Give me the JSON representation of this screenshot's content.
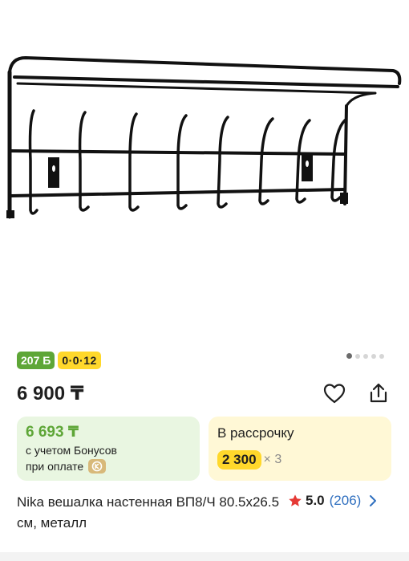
{
  "product_image": {
    "alt_name": "coat-rack-photo"
  },
  "badges": {
    "bonus": "207 Б",
    "plan": "0·0·12"
  },
  "pager": {
    "count": 5,
    "active_index": 0
  },
  "price": "6 900 ₸",
  "bonus_card": {
    "price": "6 693 ₸",
    "line1": "с учетом Бонусов",
    "line2": "при оплате"
  },
  "installment_card": {
    "title": "В рассрочку",
    "amount": "2 300",
    "multiplier": "× 3"
  },
  "product": {
    "title": "Nika вешалка настенная ВП8/Ч 80.5x26.5 см, металл"
  },
  "rating": {
    "value": "5.0",
    "count": "(206)"
  },
  "colors": {
    "bonus_green": "#5ea637",
    "plan_yellow": "#ffd82b",
    "link_blue": "#2f6fbf",
    "star_red": "#e53935"
  },
  "icons": {
    "favorite": "heart-icon",
    "share": "share-icon",
    "star": "star-icon",
    "chevron": "chevron-right-icon",
    "pay": "kaspi-pay-icon"
  }
}
